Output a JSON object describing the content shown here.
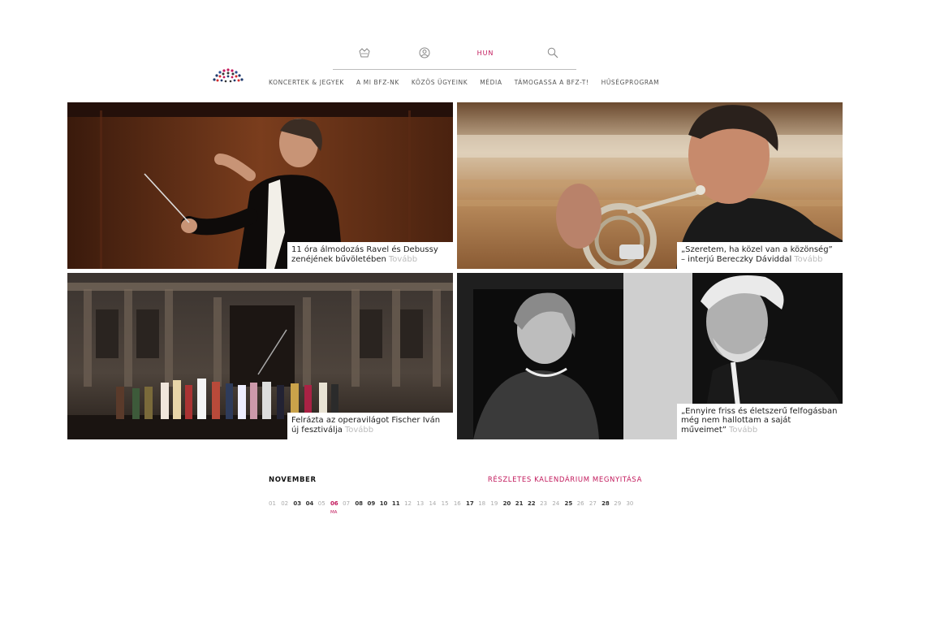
{
  "header": {
    "language": "HUN",
    "nav": [
      {
        "label": "KONCERTEK & JEGYEK"
      },
      {
        "label": "A MI BFZ-NK"
      },
      {
        "label": "KÖZÖS ÜGYEINK"
      },
      {
        "label": "MÉDIA"
      },
      {
        "label": "TÁMOGASSA A BFZ-T!"
      },
      {
        "label": "HŰSÉGPROGRAM"
      }
    ]
  },
  "tiles": [
    {
      "title": "11 óra álmodozás Ravel és Debussy zenéjének bűvöletében",
      "more": "Tovább"
    },
    {
      "title": "„Szeretem, ha közel van a közönség” – interjú Bereczky Dáviddal",
      "more": "Tovább"
    },
    {
      "title": "Felrázta az operavilágot Fischer Iván új fesztiválja",
      "more": "Tovább"
    },
    {
      "title": "„Ennyire friss és életszerű felfogásban még nem hallottam a saját műveimet”",
      "more": "Tovább"
    }
  ],
  "calendar": {
    "month": "NOVEMBER",
    "open_link": "RÉSZLETES KALENDÁRIUM MEGNYITÁSA",
    "today_label": "MA",
    "days": [
      "01",
      "02",
      "03",
      "04",
      "05",
      "06",
      "07",
      "08",
      "09",
      "10",
      "11",
      "12",
      "13",
      "14",
      "15",
      "16",
      "17",
      "18",
      "19",
      "20",
      "21",
      "22",
      "23",
      "24",
      "25",
      "26",
      "27",
      "28",
      "29",
      "30"
    ]
  },
  "colors": {
    "accent": "#c2185b",
    "muted": "#bbbbbb"
  }
}
